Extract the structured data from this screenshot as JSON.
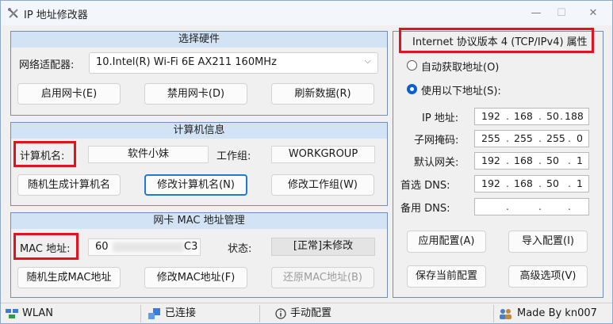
{
  "window": {
    "title": "IP 地址修改器",
    "min": "—",
    "max": "☐",
    "close": "✕"
  },
  "hardware": {
    "title": "选择硬件",
    "adapter_label": "网络适配器:",
    "adapter_value": "10.Intel(R) Wi-Fi 6E AX211 160MHz",
    "enable_btn": "启用网卡(E)",
    "disable_btn": "禁用网卡(D)",
    "refresh_btn": "刷新数据(R)"
  },
  "computer": {
    "title": "计算机信息",
    "name_label": "计算机名:",
    "name_value": "软件小妹",
    "workgroup_label": "工作组:",
    "workgroup_value": "WORKGROUP",
    "random_name_btn": "随机生成计算机名",
    "modify_name_btn": "修改计算机名(N)",
    "modify_workgroup_btn": "修改工作组(W)"
  },
  "mac": {
    "title": "网卡 MAC 地址管理",
    "mac_label": "MAC 地址:",
    "mac_prefix": "60",
    "mac_suffix": "C3",
    "status_label": "状态:",
    "status_value": "[正常]未修改",
    "random_mac_btn": "随机生成MAC地址",
    "modify_mac_btn": "修改MAC地址(F)",
    "restore_mac_btn": "还原MAC地址(B)"
  },
  "ipv4": {
    "title": "Internet 协议版本 4 (TCP/IPv4) 属性",
    "auto_label": "自动获取地址(O)",
    "manual_label": "使用以下地址(S):",
    "ip_label": "IP 地址:",
    "ip": [
      "192",
      "168",
      "50",
      "188"
    ],
    "mask_label": "子网掩码:",
    "mask": [
      "255",
      "255",
      "255",
      "0"
    ],
    "gateway_label": "默认网关:",
    "gateway": [
      "192",
      "168",
      "50",
      "1"
    ],
    "dns1_label": "首选 DNS:",
    "dns1": [
      "192",
      "168",
      "50",
      "1"
    ],
    "dns2_label": "备用 DNS:",
    "dns2": [
      "",
      "",
      "",
      ""
    ],
    "apply_btn": "应用配置(A)",
    "import_btn": "导入配置(I)",
    "save_btn": "保存当前配置",
    "advanced_btn": "高级选项(V)"
  },
  "statusbar": {
    "network": "WLAN",
    "connection": "已连接",
    "mode": "手动配置",
    "author": "Made By kn007"
  },
  "colors": {
    "accent": "#0a5fc9",
    "highlight": "#e0141e",
    "group_header": "#d3e3f6",
    "group_border": "#6f8fb8"
  }
}
